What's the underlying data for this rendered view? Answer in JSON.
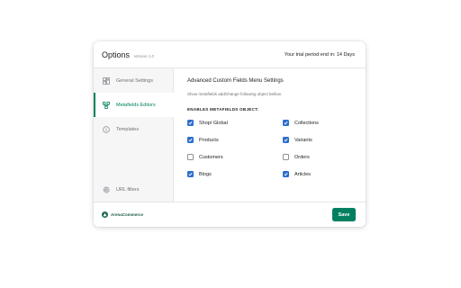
{
  "header": {
    "title": "Options",
    "version": "Version 1.0",
    "trial_text": "Your trial period end in: 14 Days"
  },
  "sidebar": {
    "items": [
      {
        "label": "General Settings",
        "icon": "layout-icon",
        "active": false
      },
      {
        "label": "Metafields Editors",
        "icon": "metafields-icon",
        "active": true
      },
      {
        "label": "Templates",
        "icon": "info-icon",
        "active": false
      },
      {
        "label": "URL filters",
        "icon": "gear-icon",
        "active": false
      }
    ]
  },
  "main": {
    "title": "Advanced Custom Fields Menu Settings",
    "description": "Show metafields add/change following object bellow.",
    "subheading": "ENABLES METAFIELDS OBJECT:",
    "checkboxes": [
      {
        "label": "Shop/ Global",
        "checked": true
      },
      {
        "label": "Collections",
        "checked": true
      },
      {
        "label": "Products",
        "checked": true
      },
      {
        "label": "Variants",
        "checked": true
      },
      {
        "label": "Customers",
        "checked": false
      },
      {
        "label": "Orders",
        "checked": false
      },
      {
        "label": "Blogs",
        "checked": true
      },
      {
        "label": "Articles",
        "checked": true
      }
    ]
  },
  "footer": {
    "brand": "ArenaCommerce",
    "save_label": "Save"
  },
  "colors": {
    "accent": "#008060",
    "checkbox": "#2c6ecb"
  }
}
